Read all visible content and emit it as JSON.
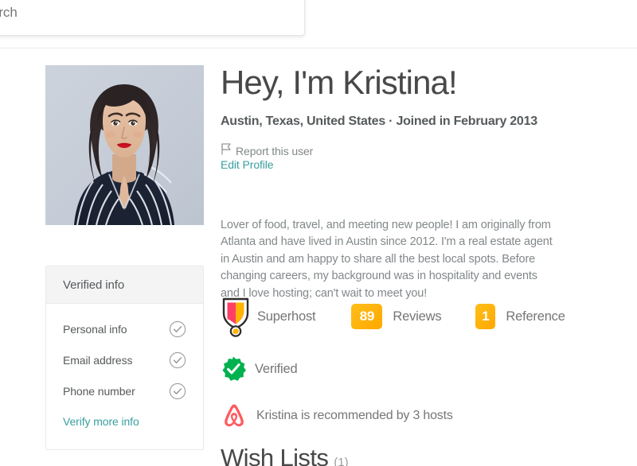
{
  "search": {
    "value": "arch",
    "placeholder": "Search"
  },
  "profile": {
    "heading": "Hey, I'm Kristina!",
    "subtitle": "Austin, Texas, United States · Joined in February 2013",
    "report_link": "Report this user",
    "edit_profile_link": "Edit Profile",
    "bio": "Lover of food, travel, and meeting new people! I am originally from Atlanta and have lived in Austin since 2012. I'm a real estate agent in Austin and am happy to share all the best local spots. Before changing careers, my background was in hospitality and events and I love hosting; can't wait to meet you!",
    "photo_alt": "Kristina profile photo"
  },
  "badges": {
    "superhost_label": "Superhost",
    "reviews_count": "89",
    "reviews_label": "Reviews",
    "reference_count": "1",
    "reference_label": "Reference",
    "verified_label": "Verified",
    "recommended_label": "Kristina is recommended by 3 hosts"
  },
  "verified_info": {
    "title": "Verified info",
    "items": [
      {
        "label": "Personal info",
        "state": "verified"
      },
      {
        "label": "Email address",
        "state": "verified"
      },
      {
        "label": "Phone number",
        "state": "verified"
      }
    ],
    "verify_more_link": "Verify more info"
  },
  "wishlists": {
    "title": "Wish Lists",
    "count": "(1)"
  },
  "colors": {
    "accent_teal": "#3a9e9f",
    "badge_amber": "#ffb400",
    "verified_green": "#00b14f",
    "brand_pink": "#ff5a5f",
    "text_dark": "#484848",
    "text_muted": "#82888a"
  }
}
